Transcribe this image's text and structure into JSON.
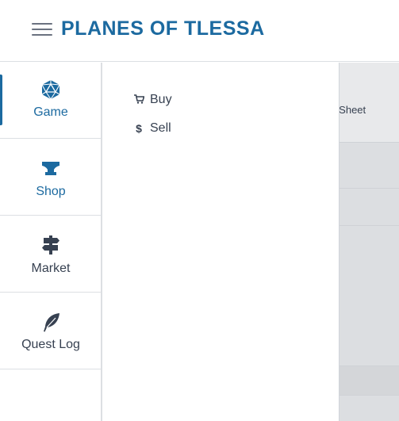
{
  "header": {
    "title": "PLANES OF TLESSA",
    "menu_icon": "hamburger-menu-icon"
  },
  "sidebar": {
    "items": [
      {
        "label": "Game",
        "icon": "d20-dice-icon",
        "active": true
      },
      {
        "label": "Shop",
        "icon": "anvil-icon",
        "active": false
      },
      {
        "label": "Market",
        "icon": "signpost-icon",
        "active": false
      },
      {
        "label": "Quest Log",
        "icon": "feather-icon",
        "active": false
      }
    ]
  },
  "submenu": {
    "items": [
      {
        "label": "Buy",
        "icon": "cart-icon"
      },
      {
        "label": "Sell",
        "icon": "dollar-icon"
      }
    ]
  },
  "background": {
    "partial_text": "er Sheet"
  },
  "colors": {
    "brand": "#1c6aa0",
    "overlay": "#dddfe2",
    "text": "#374151"
  }
}
